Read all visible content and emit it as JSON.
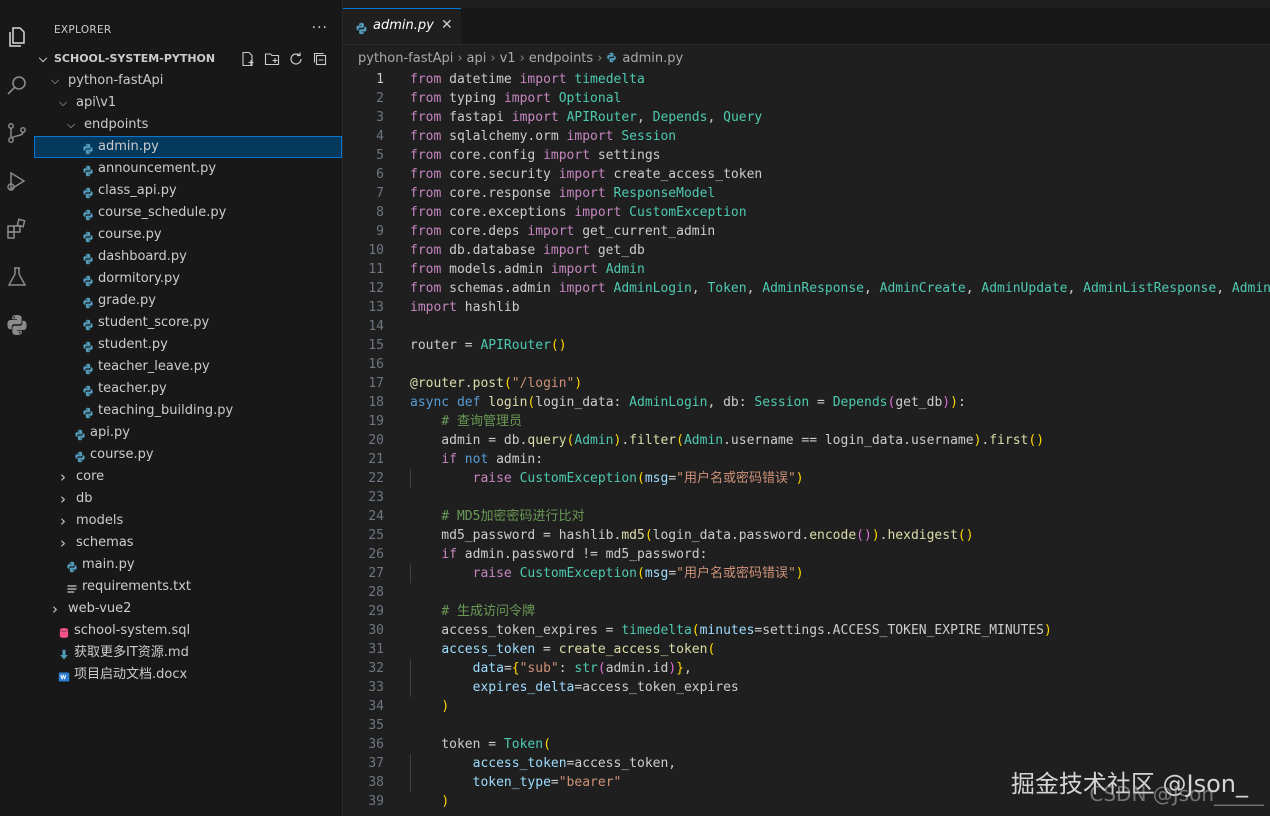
{
  "explorer": {
    "header": "EXPLORER",
    "more": "···",
    "root": "SCHOOL-SYSTEM-PYTHON",
    "tree": [
      {
        "label": "python-fastApi",
        "kind": "folder-open",
        "depth": 1
      },
      {
        "label": "api\\v1",
        "kind": "folder-open",
        "depth": 2
      },
      {
        "label": "endpoints",
        "kind": "folder-open",
        "depth": 3
      },
      {
        "label": "admin.py",
        "kind": "py",
        "depth": 4,
        "selected": true
      },
      {
        "label": "announcement.py",
        "kind": "py",
        "depth": 4
      },
      {
        "label": "class_api.py",
        "kind": "py",
        "depth": 4
      },
      {
        "label": "course_schedule.py",
        "kind": "py",
        "depth": 4
      },
      {
        "label": "course.py",
        "kind": "py",
        "depth": 4
      },
      {
        "label": "dashboard.py",
        "kind": "py",
        "depth": 4
      },
      {
        "label": "dormitory.py",
        "kind": "py",
        "depth": 4
      },
      {
        "label": "grade.py",
        "kind": "py",
        "depth": 4
      },
      {
        "label": "student_score.py",
        "kind": "py",
        "depth": 4
      },
      {
        "label": "student.py",
        "kind": "py",
        "depth": 4
      },
      {
        "label": "teacher_leave.py",
        "kind": "py",
        "depth": 4
      },
      {
        "label": "teacher.py",
        "kind": "py",
        "depth": 4
      },
      {
        "label": "teaching_building.py",
        "kind": "py",
        "depth": 4
      },
      {
        "label": "api.py",
        "kind": "py",
        "depth": 3
      },
      {
        "label": "course.py",
        "kind": "py",
        "depth": 3
      },
      {
        "label": "core",
        "kind": "folder",
        "depth": 2
      },
      {
        "label": "db",
        "kind": "folder",
        "depth": 2
      },
      {
        "label": "models",
        "kind": "folder",
        "depth": 2
      },
      {
        "label": "schemas",
        "kind": "folder",
        "depth": 2
      },
      {
        "label": "main.py",
        "kind": "py",
        "depth": 2
      },
      {
        "label": "requirements.txt",
        "kind": "txt",
        "depth": 2
      },
      {
        "label": "web-vue2",
        "kind": "folder",
        "depth": 1
      },
      {
        "label": "school-system.sql",
        "kind": "sql",
        "depth": 1
      },
      {
        "label": "获取更多IT资源.md",
        "kind": "md",
        "depth": 1
      },
      {
        "label": "项目启动文档.docx",
        "kind": "docx",
        "depth": 1
      }
    ]
  },
  "tab": {
    "label": "admin.py",
    "close": "✕"
  },
  "breadcrumb": [
    "python-fastApi",
    "api",
    "v1",
    "endpoints",
    "admin.py"
  ],
  "code": [
    "from datetime import timedelta",
    "from typing import Optional",
    "from fastapi import APIRouter, Depends, Query",
    "from sqlalchemy.orm import Session",
    "from core.config import settings",
    "from core.security import create_access_token",
    "from core.response import ResponseModel",
    "from core.exceptions import CustomException",
    "from core.deps import get_current_admin",
    "from db.database import get_db",
    "from models.admin import Admin",
    "from schemas.admin import AdminLogin, Token, AdminResponse, AdminCreate, AdminUpdate, AdminListResponse, AdminI",
    "import hashlib",
    "",
    "router = APIRouter()",
    "",
    "@router.post(\"/login\")",
    "async def login(login_data: AdminLogin, db: Session = Depends(get_db)):",
    "    # 查询管理员",
    "    admin = db.query(Admin).filter(Admin.username == login_data.username).first()",
    "    if not admin:",
    "        raise CustomException(msg=\"用户名或密码错误\")",
    "",
    "    # MD5加密密码进行比对",
    "    md5_password = hashlib.md5(login_data.password.encode()).hexdigest()",
    "    if admin.password != md5_password:",
    "        raise CustomException(msg=\"用户名或密码错误\")",
    "",
    "    # 生成访问令牌",
    "    access_token_expires = timedelta(minutes=settings.ACCESS_TOKEN_EXPIRE_MINUTES)",
    "    access_token = create_access_token(",
    "        data={\"sub\": str(admin.id)},",
    "        expires_delta=access_token_expires",
    "    )",
    "",
    "    token = Token(",
    "        access_token=access_token,",
    "        token_type=\"bearer\"",
    "    )"
  ],
  "active_line": 1,
  "watermark": {
    "line1": "掘金技术社区 @Json_",
    "line2": "CSDN @Json_____"
  },
  "colors": {
    "accent": "#0078d4",
    "selection": "#04395e",
    "python_icon": "#519aba"
  }
}
